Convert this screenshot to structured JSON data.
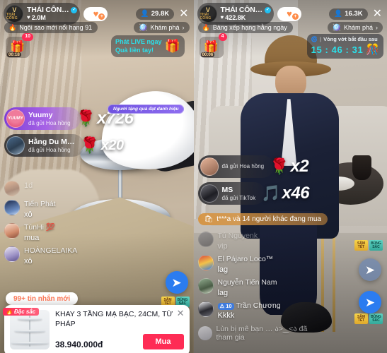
{
  "left": {
    "header": {
      "avatar_mark": "V",
      "avatar_sub": "THÁI CÔNG",
      "host_name": "THÁI CÔN…",
      "verified_glyph": "✓",
      "like_icon": "♥",
      "like_count": "2.0M",
      "follow_icon": "heart-plus-icon",
      "follow_plus": "+",
      "viewer_icon": "👤",
      "viewer_count": "29.8K",
      "close_glyph": "✕"
    },
    "rank_pill": {
      "icon": "🔥",
      "label": "Ngôi sao mới nổi hạng 91"
    },
    "discover_pill": {
      "icon": "🪩",
      "label": "Khám phá",
      "chevron": "›"
    },
    "giftbox": {
      "emoji": "🎁",
      "badge": "10",
      "timer": "00:18"
    },
    "live_promo": {
      "line1": "Phát LIVE ngay",
      "line2": "Quà liền tay!",
      "emoji": "🎁"
    },
    "honor_badge": "Người tặng quà đạt danh hiệu",
    "gifts": [
      {
        "avatar": "av-yuumy",
        "avatar_text": "YUUMY",
        "name": "Yuumy",
        "sub": "đã gửi Hoa hồng",
        "icon": "🌹",
        "multiplier": "x726"
      },
      {
        "avatar": "av-hang",
        "avatar_text": "",
        "name": "Hằng Du M…",
        "sub": "đã gửi Hoa hồng",
        "icon": "🌹",
        "multiplier": "x20"
      }
    ],
    "chat": [
      {
        "avatar": "c-a1",
        "name": "",
        "msg": "1d",
        "level": ""
      },
      {
        "avatar": "c-a2",
        "name": "Tiến Phát",
        "msg": "xô",
        "level": ""
      },
      {
        "avatar": "c-a3",
        "name": "TúnHi 💯",
        "msg": "mua",
        "level": ""
      },
      {
        "avatar": "c-a4",
        "name": "HOÀNGELAIKA",
        "msg": "xô",
        "level": ""
      }
    ],
    "new_messages": "99+ tin nhắn mới",
    "share_icon": "➤",
    "tet_stickers": [
      {
        "class": "y",
        "l1": "SĂM",
        "l2": "TẾT"
      },
      {
        "class": "t",
        "l1": "BÙNG",
        "l2": "SẮC"
      }
    ],
    "product": {
      "badge_icon": "🔥",
      "badge_label": "Đặc sắc",
      "title": "KHAY 3 TẦNG MẠ BẠC, 24CM, TỪ PHÁP",
      "price": "38.940.000đ",
      "buy_label": "Mua",
      "close_glyph": "✕"
    }
  },
  "right": {
    "header": {
      "avatar_mark": "V",
      "avatar_sub": "THÁI CÔNG",
      "host_name": "THÁI CÔN…",
      "verified_glyph": "✓",
      "like_icon": "♥",
      "like_count": "422.8K",
      "follow_icon": "heart-plus-icon",
      "follow_plus": "+",
      "viewer_icon": "👤",
      "viewer_count": "16.3K",
      "close_glyph": "✕"
    },
    "rank_pill": {
      "icon": "🔥",
      "label": "Bảng xếp hạng hằng ngày"
    },
    "discover_pill": {
      "icon": "🪩",
      "label": "Khám phá",
      "chevron": "›"
    },
    "giftbox": {
      "emoji": "🎁",
      "badge": "4",
      "timer": "00:06"
    },
    "countdown": {
      "icon": "🌀",
      "sep": "|",
      "label": "Vòng vớt bắt đầu sau",
      "time": "15 : 46 : 31",
      "emoji": "🎊"
    },
    "gifts": [
      {
        "avatar": "av-hoa",
        "avatar_text": "",
        "name": "",
        "sub": "đã gửi Hoa hồng",
        "icon": "🌹",
        "multiplier": "x2"
      },
      {
        "avatar": "av-ms",
        "avatar_text": "",
        "name": "MS",
        "sub": "đã gửi TikTok",
        "icon": "🎵",
        "multiplier": "x46"
      }
    ],
    "buy_ticker": {
      "icon": "🛍",
      "label": "t***a và 14 người khác đang mua"
    },
    "chat": [
      {
        "avatar": "c-a5",
        "name": "Tú Nguyenk",
        "msg": "vip",
        "level": ""
      },
      {
        "avatar": "c-a6",
        "name": "El Pájaro Loco™",
        "msg": "lag",
        "level": ""
      },
      {
        "avatar": "c-a7",
        "name": "Nguyễn Tiến Nam",
        "msg": "lag",
        "level": ""
      },
      {
        "avatar": "c-a8",
        "name": "Trần Chương",
        "msg": "Kkkk",
        "level": "10"
      }
    ],
    "join_notice": "Lùn bị mê bạn … ა>‿<ა đã tham gia",
    "share_icon": "➤",
    "tet_stickers": [
      {
        "class": "y",
        "l1": "SĂM",
        "l2": "TẾT"
      },
      {
        "class": "t",
        "l1": "BÙNG",
        "l2": "SẮC"
      }
    ]
  },
  "colors": {
    "accent_red": "#fe2c55",
    "accent_blue": "#2b7cf0",
    "accent_cyan": "#2be0ea",
    "gift_purple": "#7e3fd6",
    "ticker_gold": "#d6923e"
  }
}
